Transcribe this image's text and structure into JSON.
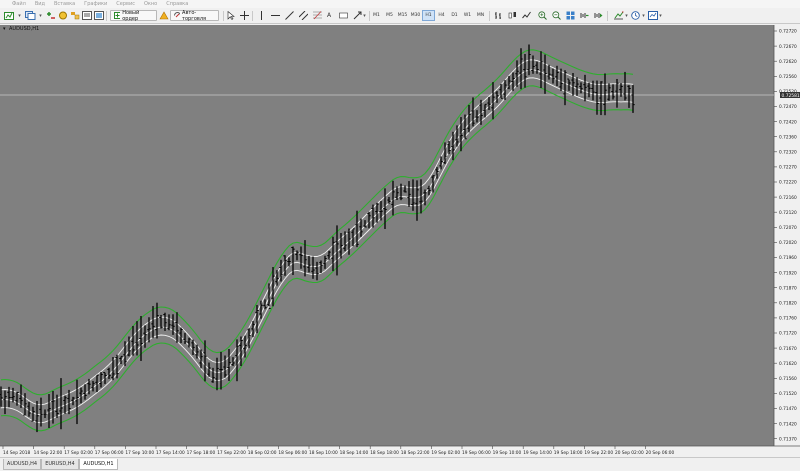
{
  "menu": [
    "Файл",
    "Вид",
    "Вставка",
    "Графики",
    "Сервис",
    "Окно",
    "Справка"
  ],
  "toolbar": {
    "new_order_label": "Новый ордер",
    "auto_trading_label": "Авто-торговля",
    "timeframes": [
      "M1",
      "M5",
      "M15",
      "M30",
      "H1",
      "H4",
      "D1",
      "W1",
      "MN"
    ],
    "active_timeframe": "H1"
  },
  "chart": {
    "header": "AUDUSD,H1",
    "current_price_label": "0.72581",
    "price_ticks": [
      "0.72720",
      "0.72670",
      "0.72620",
      "0.72560",
      "0.72520",
      "0.72470",
      "0.72420",
      "0.72360",
      "0.72320",
      "0.72270",
      "0.72220",
      "0.72160",
      "0.72120",
      "0.72070",
      "0.72020",
      "0.71960",
      "0.71920",
      "0.71870",
      "0.71820",
      "0.71760",
      "0.71720",
      "0.71670",
      "0.71620",
      "0.71560",
      "0.71520",
      "0.71470",
      "0.71420",
      "0.71370"
    ],
    "time_ticks": [
      "14 Sep 2018",
      "14 Sep 22:00",
      "17 Sep 02:00",
      "17 Sep 06:00",
      "17 Sep 10:00",
      "17 Sep 14:00",
      "17 Sep 18:00",
      "17 Sep 22:00",
      "18 Sep 02:00",
      "18 Sep 06:00",
      "18 Sep 10:00",
      "18 Sep 14:00",
      "18 Sep 18:00",
      "18 Sep 22:00",
      "19 Sep 02:00",
      "19 Sep 06:00",
      "19 Sep 10:00",
      "19 Sep 14:00",
      "19 Sep 18:00",
      "19 Sep 22:00",
      "20 Sep 02:00",
      "20 Sep 06:00"
    ],
    "colors": {
      "background": "#808080",
      "bars": "#000000",
      "green_band": "#2fae2f",
      "white_lines": "#f2f2f2",
      "price_line": "#c8c8c8"
    }
  },
  "tabs": [
    {
      "label": "AUDUSD,H4",
      "active": false
    },
    {
      "label": "EURUSD,H4",
      "active": false
    },
    {
      "label": "AUDUSD,H1",
      "active": true
    }
  ]
}
